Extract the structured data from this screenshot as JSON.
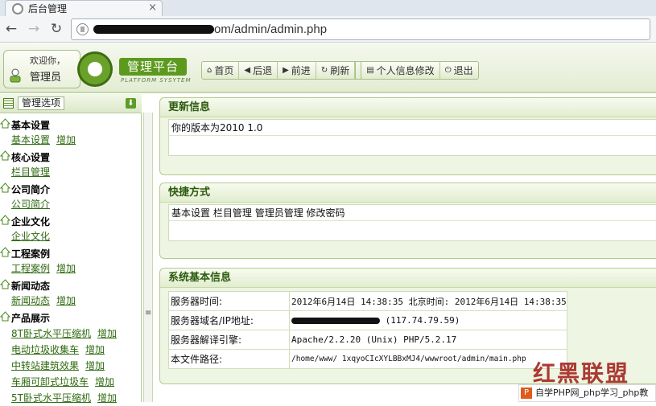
{
  "browser": {
    "tab_title": "后台管理",
    "url_path": "om/admin/admin.php"
  },
  "header": {
    "welcome": "欢迎你，",
    "role": "管理员",
    "platform_title": "管理平台",
    "platform_subtitle": "PLATFORM SYSYTEM",
    "nav": {
      "home": "首页",
      "back": "后退",
      "forward": "前进",
      "refresh": "刷新",
      "profile": "个人信息修改",
      "logout": "退出"
    }
  },
  "sidebar": {
    "header": "管理选项",
    "groups": [
      {
        "title": "基本设置",
        "links": [
          "基本设置",
          "增加"
        ]
      },
      {
        "title": "核心设置",
        "links": [
          "栏目管理"
        ]
      },
      {
        "title": "公司简介",
        "links": [
          "公司简介"
        ]
      },
      {
        "title": "企业文化",
        "links": [
          "企业文化"
        ]
      },
      {
        "title": "工程案例",
        "links": [
          "工程案例",
          "增加"
        ]
      },
      {
        "title": "新闻动态",
        "links": [
          "新闻动态",
          "增加"
        ]
      }
    ],
    "products": {
      "title": "产品展示",
      "items": [
        {
          "name": "8T卧式水平压缩机",
          "add": "增加"
        },
        {
          "name": "电动垃圾收集车",
          "add": "增加"
        },
        {
          "name": "中转站建筑效果",
          "add": "增加"
        },
        {
          "name": "车厢可卸式垃圾车",
          "add": "增加"
        },
        {
          "name": "5T卧式水平压缩机",
          "add": "增加"
        }
      ]
    }
  },
  "main": {
    "update": {
      "title": "更新信息",
      "text": "你的版本为2010 1.0"
    },
    "shortcuts": {
      "title": "快捷方式",
      "links": [
        "基本设置",
        "栏目管理",
        "管理员管理",
        "修改密码"
      ]
    },
    "sysinfo": {
      "title": "系统基本信息",
      "rows": [
        {
          "label": "服务器时间:",
          "value": "2012年6月14日 14:38:35  北京时间: 2012年6月14日 14:38:35"
        },
        {
          "label": "服务器域名/IP地址:",
          "value": "(117.74.79.59)"
        },
        {
          "label": "服务器解译引擎:",
          "value": "Apache/2.2.20 (Unix) PHP/5.2.17"
        },
        {
          "label": "本文件路径:",
          "value": "/home/www/                    1xqyoCIcXYLBBxMJ4/wwwroot/admin/main.php"
        }
      ]
    }
  },
  "watermark": {
    "brand": "红黑联盟",
    "footer": "自学PHP网_php学习_php教"
  }
}
